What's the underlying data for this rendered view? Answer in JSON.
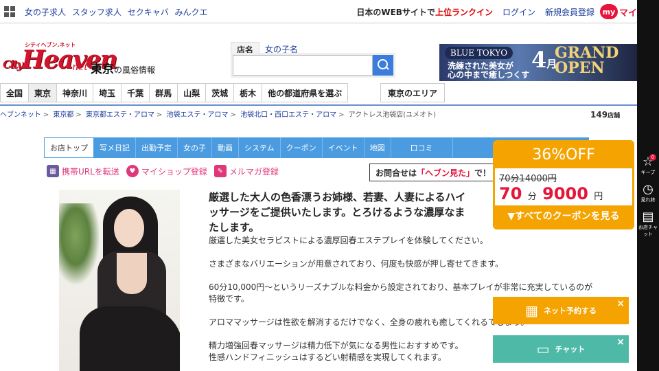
{
  "header": {
    "links": [
      "女の子求人",
      "スタッフ求人",
      "セクキャバ",
      "みんクエ"
    ],
    "tagline_prefix": "日本のWEBサイトで",
    "tagline_highlight": "上位ランクイン",
    "login": "ログイン",
    "register": "新規会員登録",
    "my_badge": "my",
    "my_text": "マイ"
  },
  "logo": {
    "top": "シティヘブン.ネット",
    "main": "Heaven",
    "city_prefix": "City",
    "net": "net",
    "region": "東京",
    "region_suffix": "の風俗情報"
  },
  "search": {
    "tabs": [
      "店名",
      "女の子名"
    ],
    "placeholder": ""
  },
  "banner": {
    "brand": "BLUE TOKYO",
    "line1": "洗練された美女が",
    "line2": "心の中まで癒しつくす",
    "month_num": "4",
    "month_unit": "月",
    "headline1": "GRAND",
    "headline2": "OPEN"
  },
  "prefectures": [
    "全国",
    "東京",
    "神奈川",
    "埼玉",
    "千葉",
    "群馬",
    "山梨",
    "茨城",
    "栃木",
    "他の都道府県を選ぶ"
  ],
  "area_button": "東京のエリア",
  "breadcrumb": [
    "ヘブンネット",
    "東京都",
    "東京都エステ・アロマ",
    "池袋エステ・アロマ",
    "池袋北口・西口エステ・アロマ",
    "アクトレス池袋店(ユメオト)"
  ],
  "shop_count": {
    "value": "149",
    "unit": "店舗"
  },
  "shop_tabs": [
    "お店トップ",
    "写メ日記",
    "出勤予定",
    "女の子",
    "動画",
    "システム",
    "クーポン",
    "イベント",
    "地図",
    "口コミ"
  ],
  "actions": [
    "携帯URLを転送",
    "マイショップ登録",
    "メルマガ登録"
  ],
  "inquiry": {
    "prefix": "お問合せは",
    "highlight": "「ヘブン見た」",
    "suffix": "で！"
  },
  "description": {
    "title_line1": "厳選した大人の色香漂うお姉様、若妻、人妻によるハイ",
    "title_line2": "ッサージをご提供いたします。とろけるような濃厚なま",
    "title_line3": "たします。",
    "paragraphs": [
      "厳選した美女セラピストによる濃厚回春エステプレイを体験してください。",
      "さまざまなバリエーションが用意されており、何度も快感が押し寄せてきます。",
      "60分10,000円～というリーズナブルな料金から設定されており、基本プレイが非常に充実しているのが特徴です。",
      "アロママッサージは性欲を解消するだけでなく、全身の疲れも癒してくれるでしょう。",
      "精力増強回春マッサージは精力低下が気になる男性におすすめです。",
      "性感ハンドフィニッシュはするどい射精感を実現してくれます。"
    ]
  },
  "coupon": {
    "discount": "36%OFF",
    "old_price": "70分14000円",
    "new_minutes": "70",
    "minutes_unit": "分",
    "new_price": "9000",
    "price_unit": "円",
    "footer": "▼すべてのクーポンを見る"
  },
  "float_buttons": {
    "reserve": "ネット予約する",
    "chat": "チャット",
    "close": "×"
  },
  "right_strip": {
    "keep_label": "キープ",
    "keep_badge": "0",
    "history_label": "見れ終",
    "chat_label": "お店チャット"
  }
}
